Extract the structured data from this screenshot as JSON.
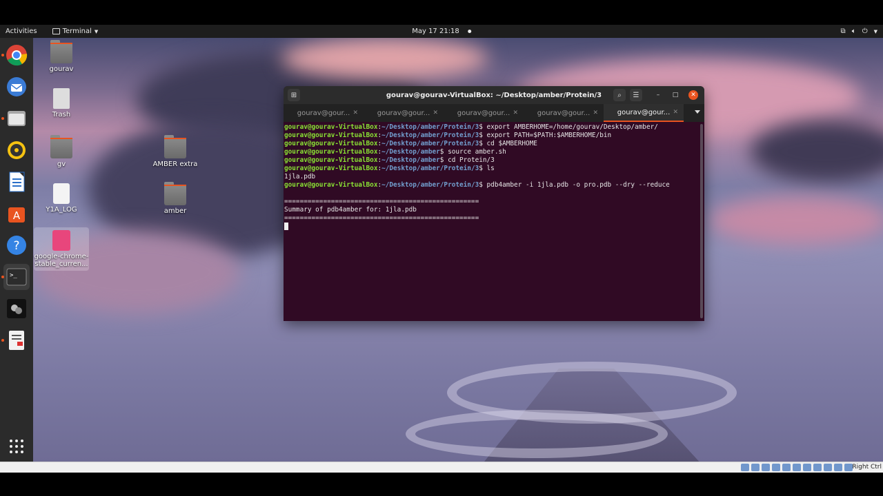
{
  "top_panel": {
    "activities": "Activities",
    "app_name": "Terminal",
    "datetime": "May 17  21:18"
  },
  "dock": {
    "items": [
      "chrome-icon",
      "thunderbird-icon",
      "files-icon",
      "rhythmbox-icon",
      "writer-icon",
      "software-icon",
      "help-icon",
      "terminal-icon",
      "app-icon",
      "document-viewer-icon"
    ]
  },
  "desktop_icons": [
    {
      "label": "gourav",
      "type": "home-folder"
    },
    {
      "label": "Trash",
      "type": "trash"
    },
    {
      "label": "gv",
      "type": "folder"
    },
    {
      "label": "AMBER extra",
      "type": "folder"
    },
    {
      "label": "Y1A_LOG",
      "type": "file"
    },
    {
      "label": "amber",
      "type": "folder"
    },
    {
      "label": "google-chrome-stable_curren...",
      "type": "package"
    }
  ],
  "terminal": {
    "title": "gourav@gourav-VirtualBox: ~/Desktop/amber/Protein/3",
    "tabs": [
      "gourav@gour...",
      "gourav@gour...",
      "gourav@gour...",
      "gourav@gour...",
      "gourav@gour..."
    ],
    "active_tab": 4,
    "lines": [
      {
        "user": "gourav@gourav-VirtualBox",
        "path": "~/Desktop/amber/Protein/3",
        "cmd": " export AMBERHOME=/home/gourav/Desktop/amber/"
      },
      {
        "user": "gourav@gourav-VirtualBox",
        "path": "~/Desktop/amber/Protein/3",
        "cmd": " export PATH=$PATH:$AMBERHOME/bin"
      },
      {
        "user": "gourav@gourav-VirtualBox",
        "path": "~/Desktop/amber/Protein/3",
        "cmd": " cd $AMBERHOME"
      },
      {
        "user": "gourav@gourav-VirtualBox",
        "path": "~/Desktop/amber",
        "cmd": " source amber.sh"
      },
      {
        "user": "gourav@gourav-VirtualBox",
        "path": "~/Desktop/amber",
        "cmd": " cd Protein/3"
      },
      {
        "user": "gourav@gourav-VirtualBox",
        "path": "~/Desktop/amber/Protein/3",
        "cmd": " ls"
      },
      {
        "text": "1jla.pdb"
      },
      {
        "user": "gourav@gourav-VirtualBox",
        "path": "~/Desktop/amber/Protein/3",
        "cmd": " pdb4amber -i 1jla.pdb -o pro.pdb --dry --reduce"
      },
      {
        "text": ""
      },
      {
        "text": "=================================================="
      },
      {
        "text": "Summary of pdb4amber for: 1jla.pdb"
      },
      {
        "text": "=================================================="
      }
    ]
  },
  "statusbar": {
    "host_key": "Right Ctrl"
  }
}
